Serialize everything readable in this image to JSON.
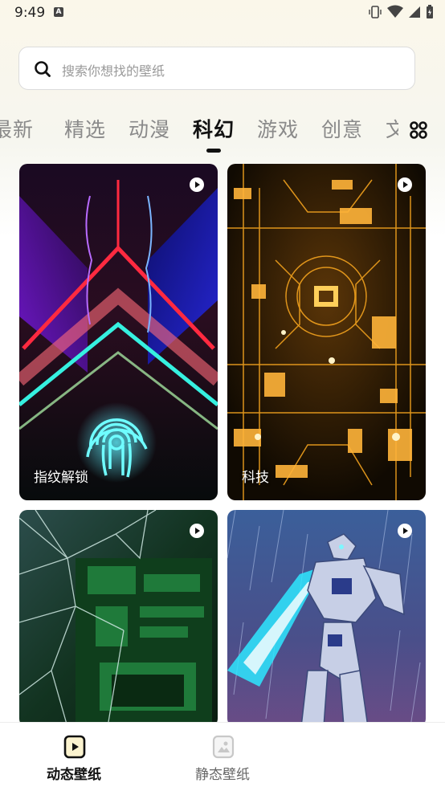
{
  "status": {
    "time": "9:49",
    "a_badge": "A"
  },
  "search": {
    "placeholder": "搜索你想找的壁纸"
  },
  "tabs": [
    {
      "label": "最新"
    },
    {
      "label": "精选"
    },
    {
      "label": "动漫"
    },
    {
      "label": "科幻",
      "active": true
    },
    {
      "label": "游戏"
    },
    {
      "label": "创意"
    },
    {
      "label": "文"
    }
  ],
  "cards": [
    {
      "label": "指纹解锁"
    },
    {
      "label": "科技"
    },
    {
      "label": ""
    },
    {
      "label": ""
    }
  ],
  "bottom_nav": [
    {
      "label": "动态壁纸",
      "active": true
    },
    {
      "label": "静态壁纸",
      "active": false
    }
  ],
  "icons": {
    "search": "search-icon",
    "grid": "grid-icon",
    "play": "play-icon",
    "dynamic": "dynamic-wallpaper-icon",
    "static": "static-wallpaper-icon"
  },
  "colors": {
    "accent": "#111111",
    "inactive_tab": "#8a8a8a"
  }
}
